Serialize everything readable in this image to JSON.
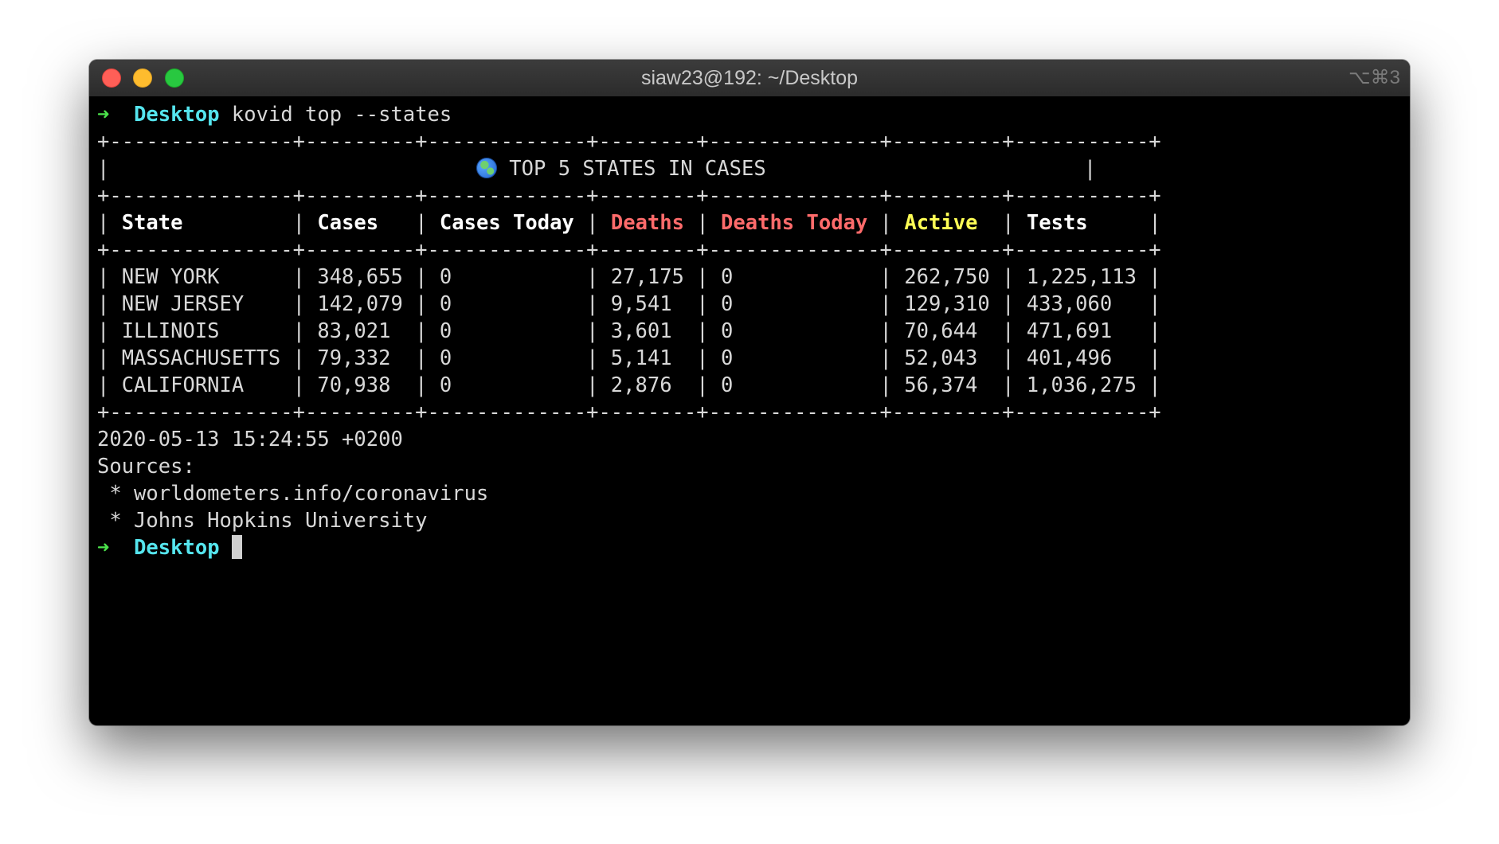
{
  "window": {
    "title": "siaw23@192: ~/Desktop",
    "shortcut": "⌥⌘3"
  },
  "prompt": {
    "arrow": "➜",
    "directory": "Desktop",
    "command": "kovid top --states"
  },
  "table": {
    "border_line": "+---------------+---------+-------------+--------+--------------+---------+-----------+",
    "title_pad_left": "|                              ",
    "title": "TOP 5 STATES IN CASES",
    "title_pad_right": "                          |",
    "headers": {
      "state": "State",
      "cases": "Cases",
      "cases_today": "Cases Today",
      "deaths": "Deaths",
      "deaths_today": "Deaths Today",
      "active": "Active",
      "tests": "Tests"
    },
    "rows": [
      "| NEW YORK      | 348,655 | 0           | 27,175 | 0            | 262,750 | 1,225,113 |",
      "| NEW JERSEY    | 142,079 | 0           | 9,541  | 0            | 129,310 | 433,060   |",
      "| ILLINOIS      | 83,021  | 0           | 3,601  | 0            | 70,644  | 471,691   |",
      "| MASSACHUSETTS | 79,332  | 0           | 5,141  | 0            | 52,043  | 401,496   |",
      "| CALIFORNIA    | 70,938  | 0           | 2,876  | 0            | 56,374  | 1,036,275 |"
    ]
  },
  "output": {
    "timestamp": "2020-05-13 15:24:55 +0200",
    "sources_label": "Sources:",
    "sources": [
      " * worldometers.info/coronavirus",
      " * Johns Hopkins University"
    ]
  },
  "icons": {
    "globe": "globe-icon"
  },
  "colors": {
    "prompt_arrow": "#4be34b",
    "directory": "#55e5ee",
    "deaths_header": "#ff6b6b",
    "active_header": "#ffff55"
  }
}
